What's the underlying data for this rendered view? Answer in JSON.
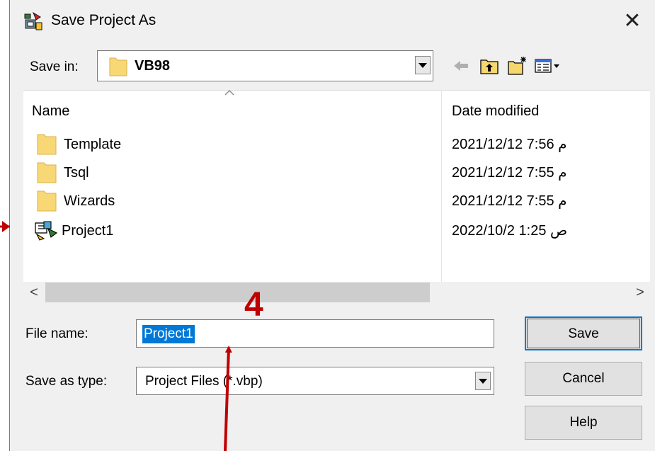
{
  "window": {
    "title": "Save Project As",
    "close_glyph": "✕",
    "title_icon": "vb-project-icon"
  },
  "save_in": {
    "label": "Save in:",
    "value": "VB98",
    "toolbar_icons": [
      "back-arrow-icon",
      "up-one-level-icon",
      "create-new-folder-icon",
      "view-menu-icon"
    ]
  },
  "file_list": {
    "columns": [
      "Name",
      "Date modified"
    ],
    "rows": [
      {
        "name": "Template",
        "date": "2021/12/12 م 7:56",
        "type": "folder"
      },
      {
        "name": "Tsql",
        "date": "2021/12/12 م 7:55",
        "type": "folder"
      },
      {
        "name": "Wizards",
        "date": "2021/12/12 م 7:55",
        "type": "folder"
      },
      {
        "name": "Project1",
        "date": "2022/10/2 ص 1:25",
        "type": "vb-project"
      }
    ]
  },
  "scrollbar": {
    "left_glyph": "<",
    "right_glyph": ">"
  },
  "form": {
    "file_name_label": "File name:",
    "file_name_value": "Project1",
    "save_as_type_label": "Save as type:",
    "save_as_type_value": "Project Files (*.vbp)"
  },
  "buttons": {
    "save": "Save",
    "cancel": "Cancel",
    "help": "Help"
  },
  "annotation": {
    "step_number": "4",
    "color": "#c00000"
  },
  "colors": {
    "selection": "#0078d7",
    "folder": "#f8d775",
    "annotation": "#c00000"
  }
}
